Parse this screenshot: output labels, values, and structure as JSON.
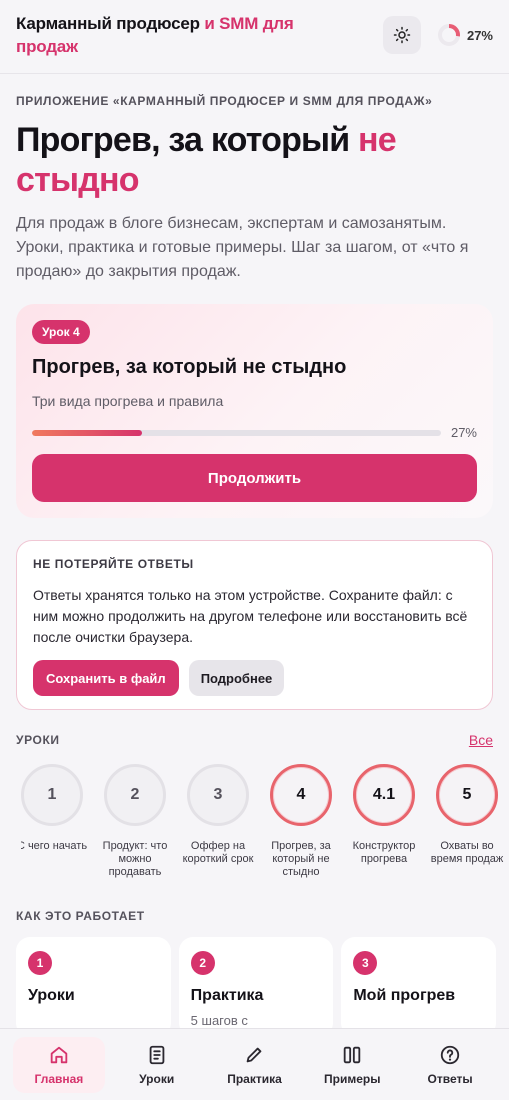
{
  "header": {
    "title_main": "Карманный продюсер",
    "title_accent": " и SMM для продаж",
    "progress": "27%",
    "progress_value": 0.27
  },
  "hero": {
    "eyebrow": "ПРИЛОЖЕНИЕ «КАРМАННЫЙ ПРОДЮСЕР И SMM ДЛЯ ПРОДАЖ»",
    "title_main": "Прогрев, за который ",
    "title_accent": "не стыдно",
    "description": "Для продаж в блоге бизнесам, экспертам и самозанятым. Уроки, практика и готовые примеры. Шаг за шагом, от «что я продаю» до закрытия продаж."
  },
  "current_lesson": {
    "badge": "Урок 4",
    "title": "Прогрев, за который не стыдно",
    "subtitle": "Три вида прогрева и правила",
    "progress_label": "27%",
    "progress_value": 0.27,
    "button": "Продолжить"
  },
  "save_card": {
    "title": "НЕ ПОТЕРЯЙТЕ ОТВЕТЫ",
    "text": "Ответы хранятся только на этом устройстве. Сохраните файл: с ним можно продолжить на другом телефоне или восстановить всё после очистки браузера.",
    "save_button": "Сохранить в файл",
    "more_button": "Подробнее"
  },
  "lessons": {
    "label": "УРОКИ",
    "all_link": "Все",
    "items": [
      {
        "num": "1",
        "caption": "С чего начать",
        "active": false
      },
      {
        "num": "2",
        "caption": "Продукт: что можно продавать",
        "active": false
      },
      {
        "num": "3",
        "caption": "Оффер на короткий срок",
        "active": false
      },
      {
        "num": "4",
        "caption": "Прогрев, за который не стыдно",
        "active": true
      },
      {
        "num": "4.1",
        "caption": "Конструктор прогрева",
        "active": true
      },
      {
        "num": "5",
        "caption": "Охваты во время продаж",
        "active": true
      }
    ]
  },
  "how_it_works": {
    "label": "КАК ЭТО РАБОТАЕТ",
    "cards": [
      {
        "num": "1",
        "title": "Уроки",
        "sub": ""
      },
      {
        "num": "2",
        "title": "Практика",
        "sub": "5 шагов с"
      },
      {
        "num": "3",
        "title": "Мой прогрев",
        "sub": ""
      }
    ]
  },
  "nav": {
    "items": [
      {
        "label": "Главная",
        "icon": "home-icon",
        "active": true
      },
      {
        "label": "Уроки",
        "icon": "document-icon",
        "active": false
      },
      {
        "label": "Практика",
        "icon": "pencil-icon",
        "active": false
      },
      {
        "label": "Примеры",
        "icon": "columns-icon",
        "active": false
      },
      {
        "label": "Ответы",
        "icon": "question-icon",
        "active": false
      }
    ]
  },
  "colors": {
    "accent": "#d6336c",
    "background": "#f6f5f8"
  }
}
